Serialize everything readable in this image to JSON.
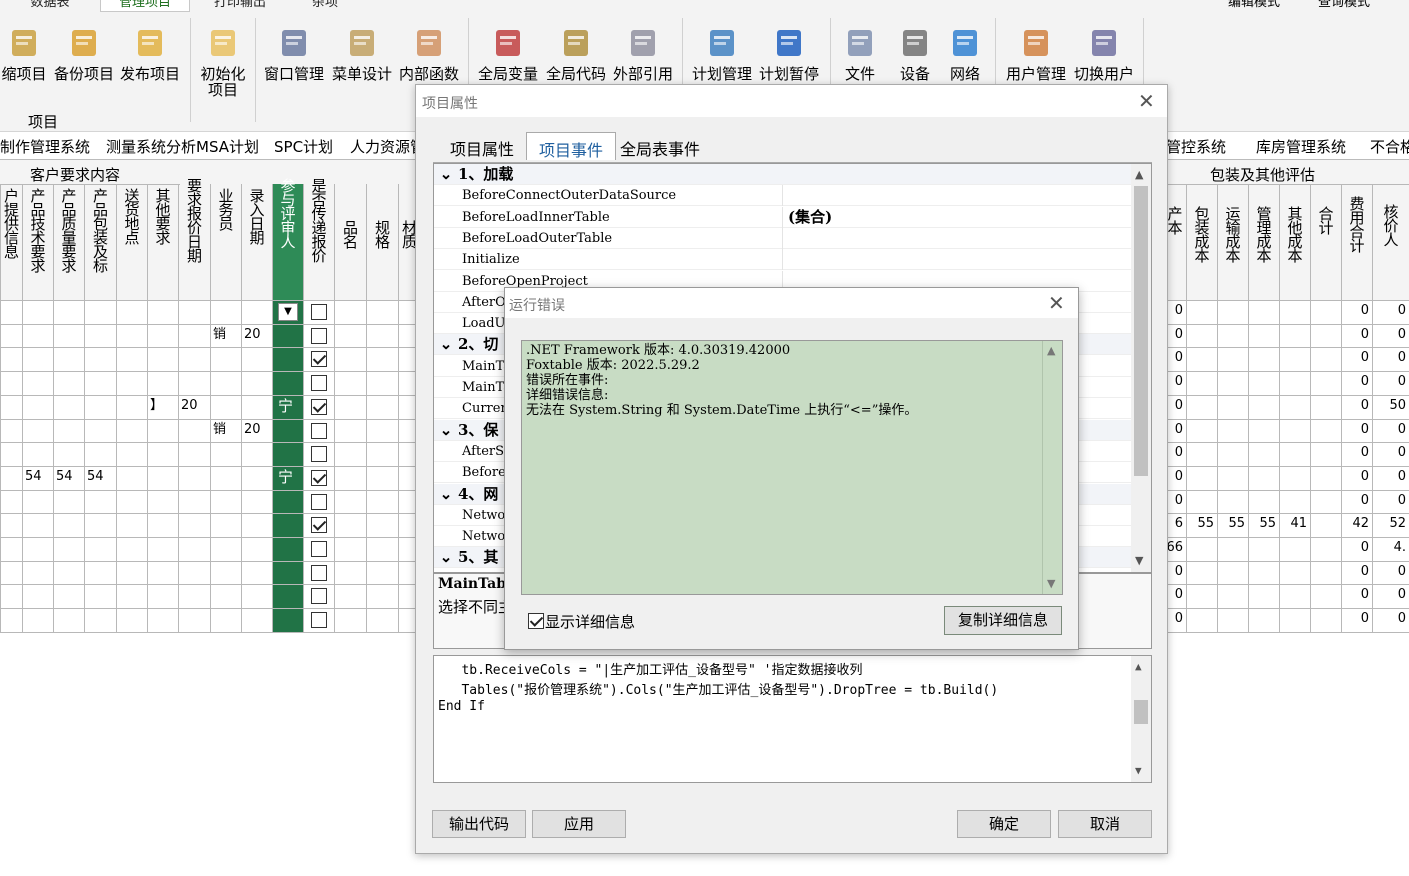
{
  "ribbon": {
    "tabs": [
      "数据表",
      "管理项目",
      "打印输出",
      "杂项"
    ],
    "right_links": [
      "编辑模式",
      "查询模式"
    ],
    "buttons": [
      "缩项目",
      "备份项目",
      "发布项目",
      "初始化项目",
      "窗口管理",
      "菜单设计",
      "内部函数",
      "全局变量",
      "全局代码",
      "外部引用",
      "计划管理",
      "计划暂停",
      "文件",
      "设备",
      "网络",
      "用户管理",
      "切换用户"
    ],
    "group_label": "项目"
  },
  "module_tabs": [
    "制作管理系统",
    "测量系统分析MSA计划",
    "SPC计划",
    "人力资源管",
    "管控系统",
    "库房管理系统",
    "不合格"
  ],
  "grid": {
    "group_left": "客户要求内容",
    "group_right": "包装及其他评估",
    "headers_left": [
      "户提供信息",
      "产品技术要求",
      "产品质量要求",
      "产品包装及标",
      "送货地点",
      "其他要求",
      "要求报价日期",
      "业务员",
      "录入日期",
      "参与评审人",
      "是否传递报价",
      "品名",
      "规格",
      "材质"
    ],
    "headers_right": [
      "产本",
      "包装成本",
      "运输成本",
      "管理成本",
      "其他成本",
      "合计",
      "费用合计",
      "核价人"
    ],
    "rows": [
      {
        "c": [
          "",
          "",
          "",
          "",
          "",
          "",
          "",
          "",
          "",
          "",
          "",
          "",
          ""
        ],
        "chk": false,
        "green": "",
        "right": [
          "0",
          "",
          "",
          "",
          "",
          "",
          "0",
          "0"
        ]
      },
      {
        "c": [
          "",
          "",
          "",
          "",
          "",
          "",
          "",
          "销",
          "20",
          "",
          "",
          "",
          ""
        ],
        "chk": false,
        "green": "",
        "right": [
          "0",
          "",
          "",
          "",
          "",
          "",
          "0",
          "0"
        ]
      },
      {
        "c": [
          "",
          "",
          "",
          "",
          "",
          "",
          "",
          "",
          "",
          "",
          "",
          "",
          ""
        ],
        "chk": true,
        "green": "",
        "right": [
          "0",
          "",
          "",
          "",
          "",
          "",
          "0",
          "0"
        ]
      },
      {
        "c": [
          "",
          "",
          "",
          "",
          "",
          "",
          "",
          "",
          "",
          "",
          "",
          "",
          ""
        ],
        "chk": false,
        "green": "",
        "right": [
          "0",
          "",
          "",
          "",
          "",
          "",
          "0",
          "0"
        ]
      },
      {
        "c": [
          "",
          "",
          "",
          "",
          "",
          "】",
          "20",
          "",
          "",
          "",
          "",
          "",
          ""
        ],
        "chk": true,
        "green": "宁",
        "right": [
          "0",
          "",
          "",
          "",
          "",
          "",
          "0",
          "50"
        ]
      },
      {
        "c": [
          "",
          "",
          "",
          "",
          "",
          "",
          "",
          "销",
          "20",
          "",
          "",
          "",
          ""
        ],
        "chk": false,
        "green": "",
        "right": [
          "0",
          "",
          "",
          "",
          "",
          "",
          "0",
          "0"
        ]
      },
      {
        "c": [
          "",
          "",
          "",
          "",
          "",
          "",
          "",
          "",
          "",
          "",
          "",
          "",
          ""
        ],
        "chk": false,
        "green": "",
        "right": [
          "0",
          "",
          "",
          "",
          "",
          "",
          "0",
          "0"
        ]
      },
      {
        "c": [
          "",
          "54",
          "54",
          "54",
          "",
          "",
          "",
          "",
          "",
          "",
          "",
          "",
          ""
        ],
        "chk": true,
        "green": "宁",
        "right": [
          "0",
          "",
          "",
          "",
          "",
          "",
          "0",
          "0"
        ]
      },
      {
        "c": [
          "",
          "",
          "",
          "",
          "",
          "",
          "",
          "",
          "",
          "",
          "",
          "",
          ""
        ],
        "chk": false,
        "green": "",
        "right": [
          "0",
          "",
          "",
          "",
          "",
          "",
          "0",
          "0"
        ]
      },
      {
        "c": [
          "",
          "",
          "",
          "",
          "",
          "",
          "",
          "",
          "",
          "",
          "",
          "",
          ""
        ],
        "chk": true,
        "green": "",
        "right": [
          "6",
          "55",
          "55",
          "55",
          "41",
          "",
          "42",
          "52"
        ]
      },
      {
        "c": [
          "",
          "",
          "",
          "",
          "",
          "",
          "",
          "",
          "",
          "",
          "",
          "",
          ""
        ],
        "chk": false,
        "green": "",
        "right": [
          "66",
          "",
          "",
          "",
          "",
          "",
          "0",
          "4."
        ]
      },
      {
        "c": [
          "",
          "",
          "",
          "",
          "",
          "",
          "",
          "",
          "",
          "",
          "",
          "",
          ""
        ],
        "chk": false,
        "green": "",
        "right": [
          "0",
          "",
          "",
          "",
          "",
          "",
          "0",
          "0"
        ]
      },
      {
        "c": [
          "",
          "",
          "",
          "",
          "",
          "",
          "",
          "",
          "",
          "",
          "",
          "",
          ""
        ],
        "chk": false,
        "green": "",
        "right": [
          "0",
          "",
          "",
          "",
          "",
          "",
          "0",
          "0"
        ]
      },
      {
        "c": [
          "",
          "",
          "",
          "",
          "",
          "",
          "",
          "",
          "",
          "",
          "",
          "",
          ""
        ],
        "chk": false,
        "green": "",
        "right": [
          "0",
          "",
          "",
          "",
          "",
          "",
          "0",
          "0"
        ]
      }
    ]
  },
  "dialog": {
    "title": "项目属性",
    "tabs": [
      "项目属性",
      "项目事件",
      "全局表事件"
    ],
    "rows": [
      {
        "type": "cat",
        "text": "1、加载"
      },
      {
        "type": "item",
        "text": "BeforeConnectOuterDataSource",
        "value": ""
      },
      {
        "type": "item",
        "text": "BeforeLoadInnerTable",
        "value": "(集合)"
      },
      {
        "type": "item",
        "text": "BeforeLoadOuterTable",
        "value": ""
      },
      {
        "type": "item",
        "text": "Initialize",
        "value": ""
      },
      {
        "type": "item",
        "text": "BeforeOpenProject",
        "value": ""
      },
      {
        "type": "item",
        "text": "AfterO",
        "value": ""
      },
      {
        "type": "item",
        "text": "LoadUs",
        "value": ""
      },
      {
        "type": "cat",
        "text": "2、切"
      },
      {
        "type": "item",
        "text": "MainTa",
        "value": ""
      },
      {
        "type": "item",
        "text": "MainTa",
        "value": ""
      },
      {
        "type": "item",
        "text": "Curren",
        "value": ""
      },
      {
        "type": "cat",
        "text": "3、保"
      },
      {
        "type": "item",
        "text": "AfterS",
        "value": ""
      },
      {
        "type": "item",
        "text": "Before",
        "value": ""
      },
      {
        "type": "cat",
        "text": "4、网"
      },
      {
        "type": "item",
        "text": "Networ",
        "value": ""
      },
      {
        "type": "item",
        "text": "Networ",
        "value": ""
      },
      {
        "type": "cat",
        "text": "5、其"
      }
    ],
    "desc_title": "MainTabl",
    "desc_text": "选择不同主",
    "code_lines": [
      "   tb.ReceiveCols = \"|生产加工评估_设备型号\" '指定数据接收列",
      "   Tables(\"报价管理系统\").Cols(\"生产加工评估_设备型号\").DropTree = tb.Build()",
      "End If"
    ],
    "buttons": {
      "export": "输出代码",
      "apply": "应用",
      "ok": "确定",
      "cancel": "取消"
    }
  },
  "error": {
    "title": "运行错误",
    "text": ".NET Framework 版本: 4.0.30319.42000\nFoxtable 版本: 2022.5.29.2\n错误所在事件:\n详细错误信息:\n无法在 System.String 和 System.DateTime 上执行“<=”操作。",
    "show_details": "显示详细信息",
    "copy": "复制详细信息"
  }
}
